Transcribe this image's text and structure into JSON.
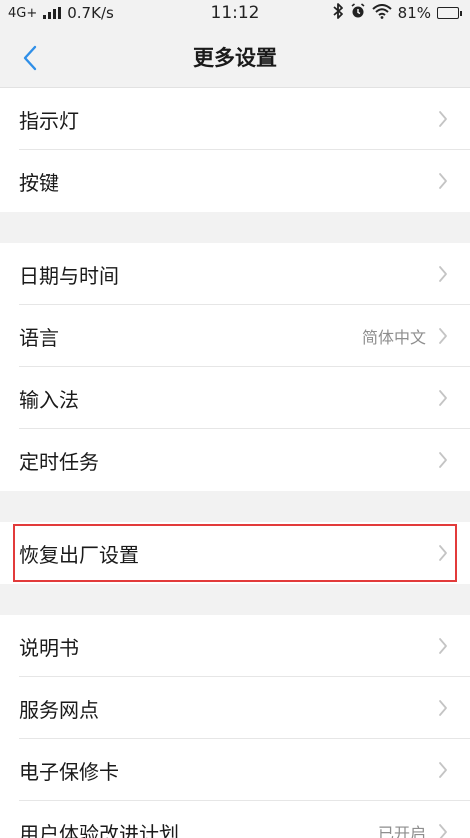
{
  "status_bar": {
    "network": "4G+",
    "speed": "0.7K/s",
    "time": "11:12",
    "battery_percent": "81%",
    "battery_level": 0.81,
    "icons": [
      "signal-icon",
      "bluetooth-icon",
      "alarm-icon",
      "wifi-icon",
      "battery-icon"
    ]
  },
  "nav": {
    "title": "更多设置",
    "back_icon": "chevron-left-icon",
    "accent": "#2f8fe8"
  },
  "groups": [
    {
      "items": [
        {
          "label": "指示灯"
        },
        {
          "label": "按键"
        }
      ]
    },
    {
      "items": [
        {
          "label": "日期与时间"
        },
        {
          "label": "语言",
          "value": "简体中文"
        },
        {
          "label": "输入法"
        },
        {
          "label": "定时任务"
        }
      ]
    },
    {
      "items": [
        {
          "label": "恢复出厂设置",
          "highlighted": true
        }
      ]
    },
    {
      "items": [
        {
          "label": "说明书"
        },
        {
          "label": "服务网点"
        },
        {
          "label": "电子保修卡"
        },
        {
          "label": "用户体验改进计划",
          "value": "已开启"
        }
      ]
    }
  ],
  "colors": {
    "highlight_border": "#e23b3b",
    "chevron": "#c4c4c4",
    "background": "#f2f2f2"
  }
}
